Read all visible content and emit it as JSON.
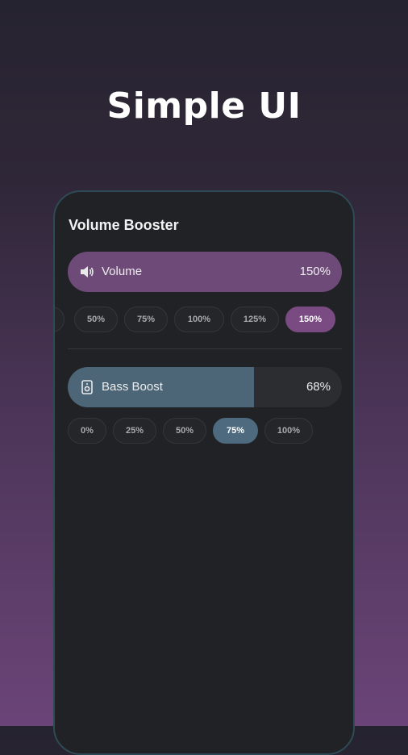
{
  "headline": "Simple UI",
  "app": {
    "title": "Volume Booster",
    "volume": {
      "label": "Volume",
      "value_text": "150%",
      "level": 1.0,
      "icon": "speaker-icon",
      "color": "#6e4a78",
      "presets": [
        "50%",
        "75%",
        "100%",
        "125%",
        "150%"
      ],
      "selected": "150%"
    },
    "bass": {
      "label": "Bass Boost",
      "value_text": "68%",
      "level": 0.68,
      "icon": "speaker-box-icon",
      "color": "#4c6577",
      "presets": [
        "0%",
        "25%",
        "50%",
        "75%",
        "100%"
      ],
      "selected": "75%"
    }
  },
  "colors": {
    "background_top": "#262330",
    "background_bottom": "#6b4478",
    "phone_bg": "#212226",
    "phone_border": "#2e4a55"
  }
}
